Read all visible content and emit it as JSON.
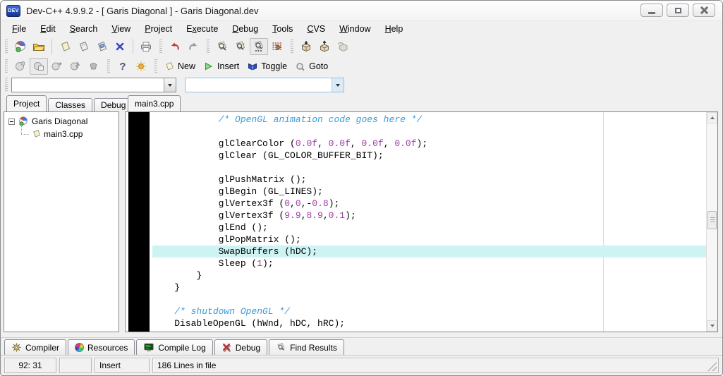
{
  "window": {
    "title": "Dev-C++ 4.9.9.2  -  [ Garis Diagonal ] - Garis Diagonal.dev",
    "app_icon_text": "DEV",
    "controls": [
      "minimize",
      "restore",
      "close"
    ]
  },
  "menu": {
    "items": [
      {
        "label": "File",
        "u": 0
      },
      {
        "label": "Edit",
        "u": 0
      },
      {
        "label": "Search",
        "u": 0
      },
      {
        "label": "View",
        "u": 0
      },
      {
        "label": "Project",
        "u": 0
      },
      {
        "label": "Execute",
        "u": 1
      },
      {
        "label": "Debug",
        "u": 0
      },
      {
        "label": "Tools",
        "u": 0
      },
      {
        "label": "CVS",
        "u": 0
      },
      {
        "label": "Window",
        "u": 0
      },
      {
        "label": "Help",
        "u": 0
      }
    ]
  },
  "toolbar_main": {
    "icons": [
      "new-project-icon",
      "open-project-icon",
      "new-file-icon",
      "save-icon",
      "save-all-icon",
      "close-file-icon",
      "print-icon",
      "undo-icon",
      "redo-icon",
      "find-icon",
      "find-next-icon",
      "replace-icon",
      "goto-line-icon",
      "compile-icon",
      "run-icon",
      "rebuild-icon"
    ]
  },
  "toolbar_debug": {
    "icons": [
      "debug-run-icon",
      "debug-window-icon",
      "step-over-icon",
      "run-to-cursor-icon",
      "stop-icon",
      "help-icon",
      "profile-icon"
    ],
    "buttons": [
      {
        "label": "New",
        "icon": "new-unit-icon"
      },
      {
        "label": "Insert",
        "icon": "insert-icon"
      },
      {
        "label": "Toggle",
        "icon": "toggle-bookmark-icon"
      },
      {
        "label": "Goto",
        "icon": "goto-bookmark-icon"
      }
    ]
  },
  "combo_row": {
    "compiler_combo": {
      "value": ""
    },
    "class_combo": {
      "value": ""
    }
  },
  "sidebar": {
    "tabs": [
      {
        "label": "Project",
        "active": true
      },
      {
        "label": "Classes",
        "active": false
      },
      {
        "label": "Debug",
        "active": false
      }
    ],
    "tree": {
      "root_label": "Garis Diagonal",
      "children": [
        {
          "label": "main3.cpp"
        }
      ]
    }
  },
  "editor": {
    "tab_label": "main3.cpp",
    "syntax_colors": {
      "comment": "#3B9CDB",
      "number": "#A23BA2",
      "plain": "#000000",
      "highlight_bg": "#CDF3F3"
    },
    "lines": [
      {
        "seg": [
          [
            "            ",
            "p"
          ],
          [
            "/* OpenGL animation code goes here */",
            "c"
          ]
        ]
      },
      {
        "seg": []
      },
      {
        "seg": [
          [
            "            glClearColor (",
            "p"
          ],
          [
            "0.0f",
            "n"
          ],
          [
            ", ",
            "p"
          ],
          [
            "0.0f",
            "n"
          ],
          [
            ", ",
            "p"
          ],
          [
            "0.0f",
            "n"
          ],
          [
            ", ",
            "p"
          ],
          [
            "0.0f",
            "n"
          ],
          [
            ");",
            "p"
          ]
        ]
      },
      {
        "seg": [
          [
            "            glClear (GL_COLOR_BUFFER_BIT);",
            "p"
          ]
        ]
      },
      {
        "seg": []
      },
      {
        "seg": [
          [
            "            glPushMatrix ();",
            "p"
          ]
        ]
      },
      {
        "seg": [
          [
            "            glBegin (GL_LINES);",
            "p"
          ]
        ]
      },
      {
        "seg": [
          [
            "            glVertex3f (",
            "p"
          ],
          [
            "0",
            "n"
          ],
          [
            ",",
            "p"
          ],
          [
            "0",
            "n"
          ],
          [
            ",-",
            "p"
          ],
          [
            "0.8",
            "n"
          ],
          [
            ");",
            "p"
          ]
        ]
      },
      {
        "seg": [
          [
            "            glVertex3f (",
            "p"
          ],
          [
            "9.9",
            "n"
          ],
          [
            ",",
            "p"
          ],
          [
            "8.9",
            "n"
          ],
          [
            ",",
            "p"
          ],
          [
            "0.1",
            "n"
          ],
          [
            ");",
            "p"
          ]
        ]
      },
      {
        "seg": [
          [
            "            glEnd ();",
            "p"
          ]
        ]
      },
      {
        "seg": [
          [
            "            glPopMatrix ();",
            "p"
          ]
        ]
      },
      {
        "hl": true,
        "seg": [
          [
            "            SwapBuffers (hDC);",
            "p"
          ]
        ]
      },
      {
        "seg": [
          [
            "            Sleep (",
            "p"
          ],
          [
            "1",
            "n"
          ],
          [
            ");",
            "p"
          ]
        ]
      },
      {
        "seg": [
          [
            "        }",
            "p"
          ]
        ]
      },
      {
        "seg": [
          [
            "    }",
            "p"
          ]
        ]
      },
      {
        "seg": []
      },
      {
        "seg": [
          [
            "    ",
            "p"
          ],
          [
            "/* shutdown OpenGL */",
            "c"
          ]
        ]
      },
      {
        "seg": [
          [
            "    DisableOpenGL (hWnd, hDC, hRC);",
            "p"
          ]
        ]
      }
    ]
  },
  "bottom_tabs": {
    "tabs": [
      {
        "label": "Compiler",
        "icon": "compiler-gear-icon"
      },
      {
        "label": "Resources",
        "icon": "resources-wheel-icon"
      },
      {
        "label": "Compile Log",
        "icon": "compile-log-screen-icon"
      },
      {
        "label": "Debug",
        "icon": "debug-x-icon"
      },
      {
        "label": "Find Results",
        "icon": "find-results-icon"
      }
    ]
  },
  "status_bar": {
    "cursor_position": "92: 31",
    "panel2": "",
    "insert_mode": "Insert",
    "line_count": "186 Lines in file"
  }
}
